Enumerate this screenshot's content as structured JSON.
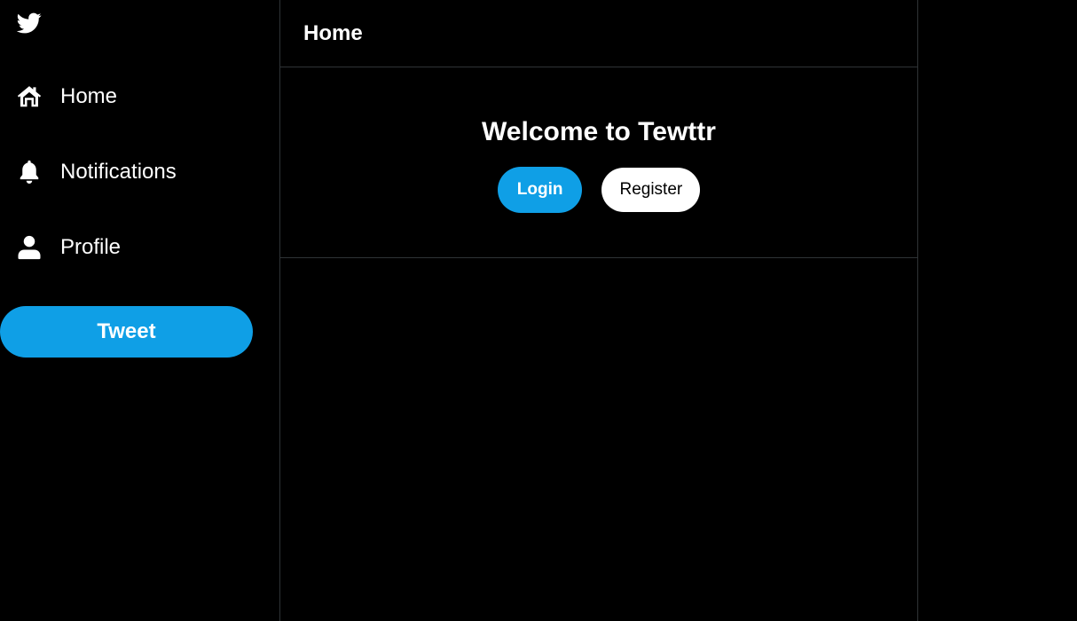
{
  "sidebar": {
    "logo_icon": "bird-logo-icon",
    "items": [
      {
        "label": "Home",
        "icon": "home-icon"
      },
      {
        "label": "Notifications",
        "icon": "bell-icon"
      },
      {
        "label": "Profile",
        "icon": "user-icon"
      }
    ],
    "tweet_label": "Tweet"
  },
  "main": {
    "title": "Home",
    "welcome_title": "Welcome to Tewttr",
    "login_label": "Login",
    "register_label": "Register"
  },
  "colors": {
    "accent": "#0f9fe6",
    "background": "#000000",
    "border": "#2f3336",
    "text": "#ffffff"
  }
}
